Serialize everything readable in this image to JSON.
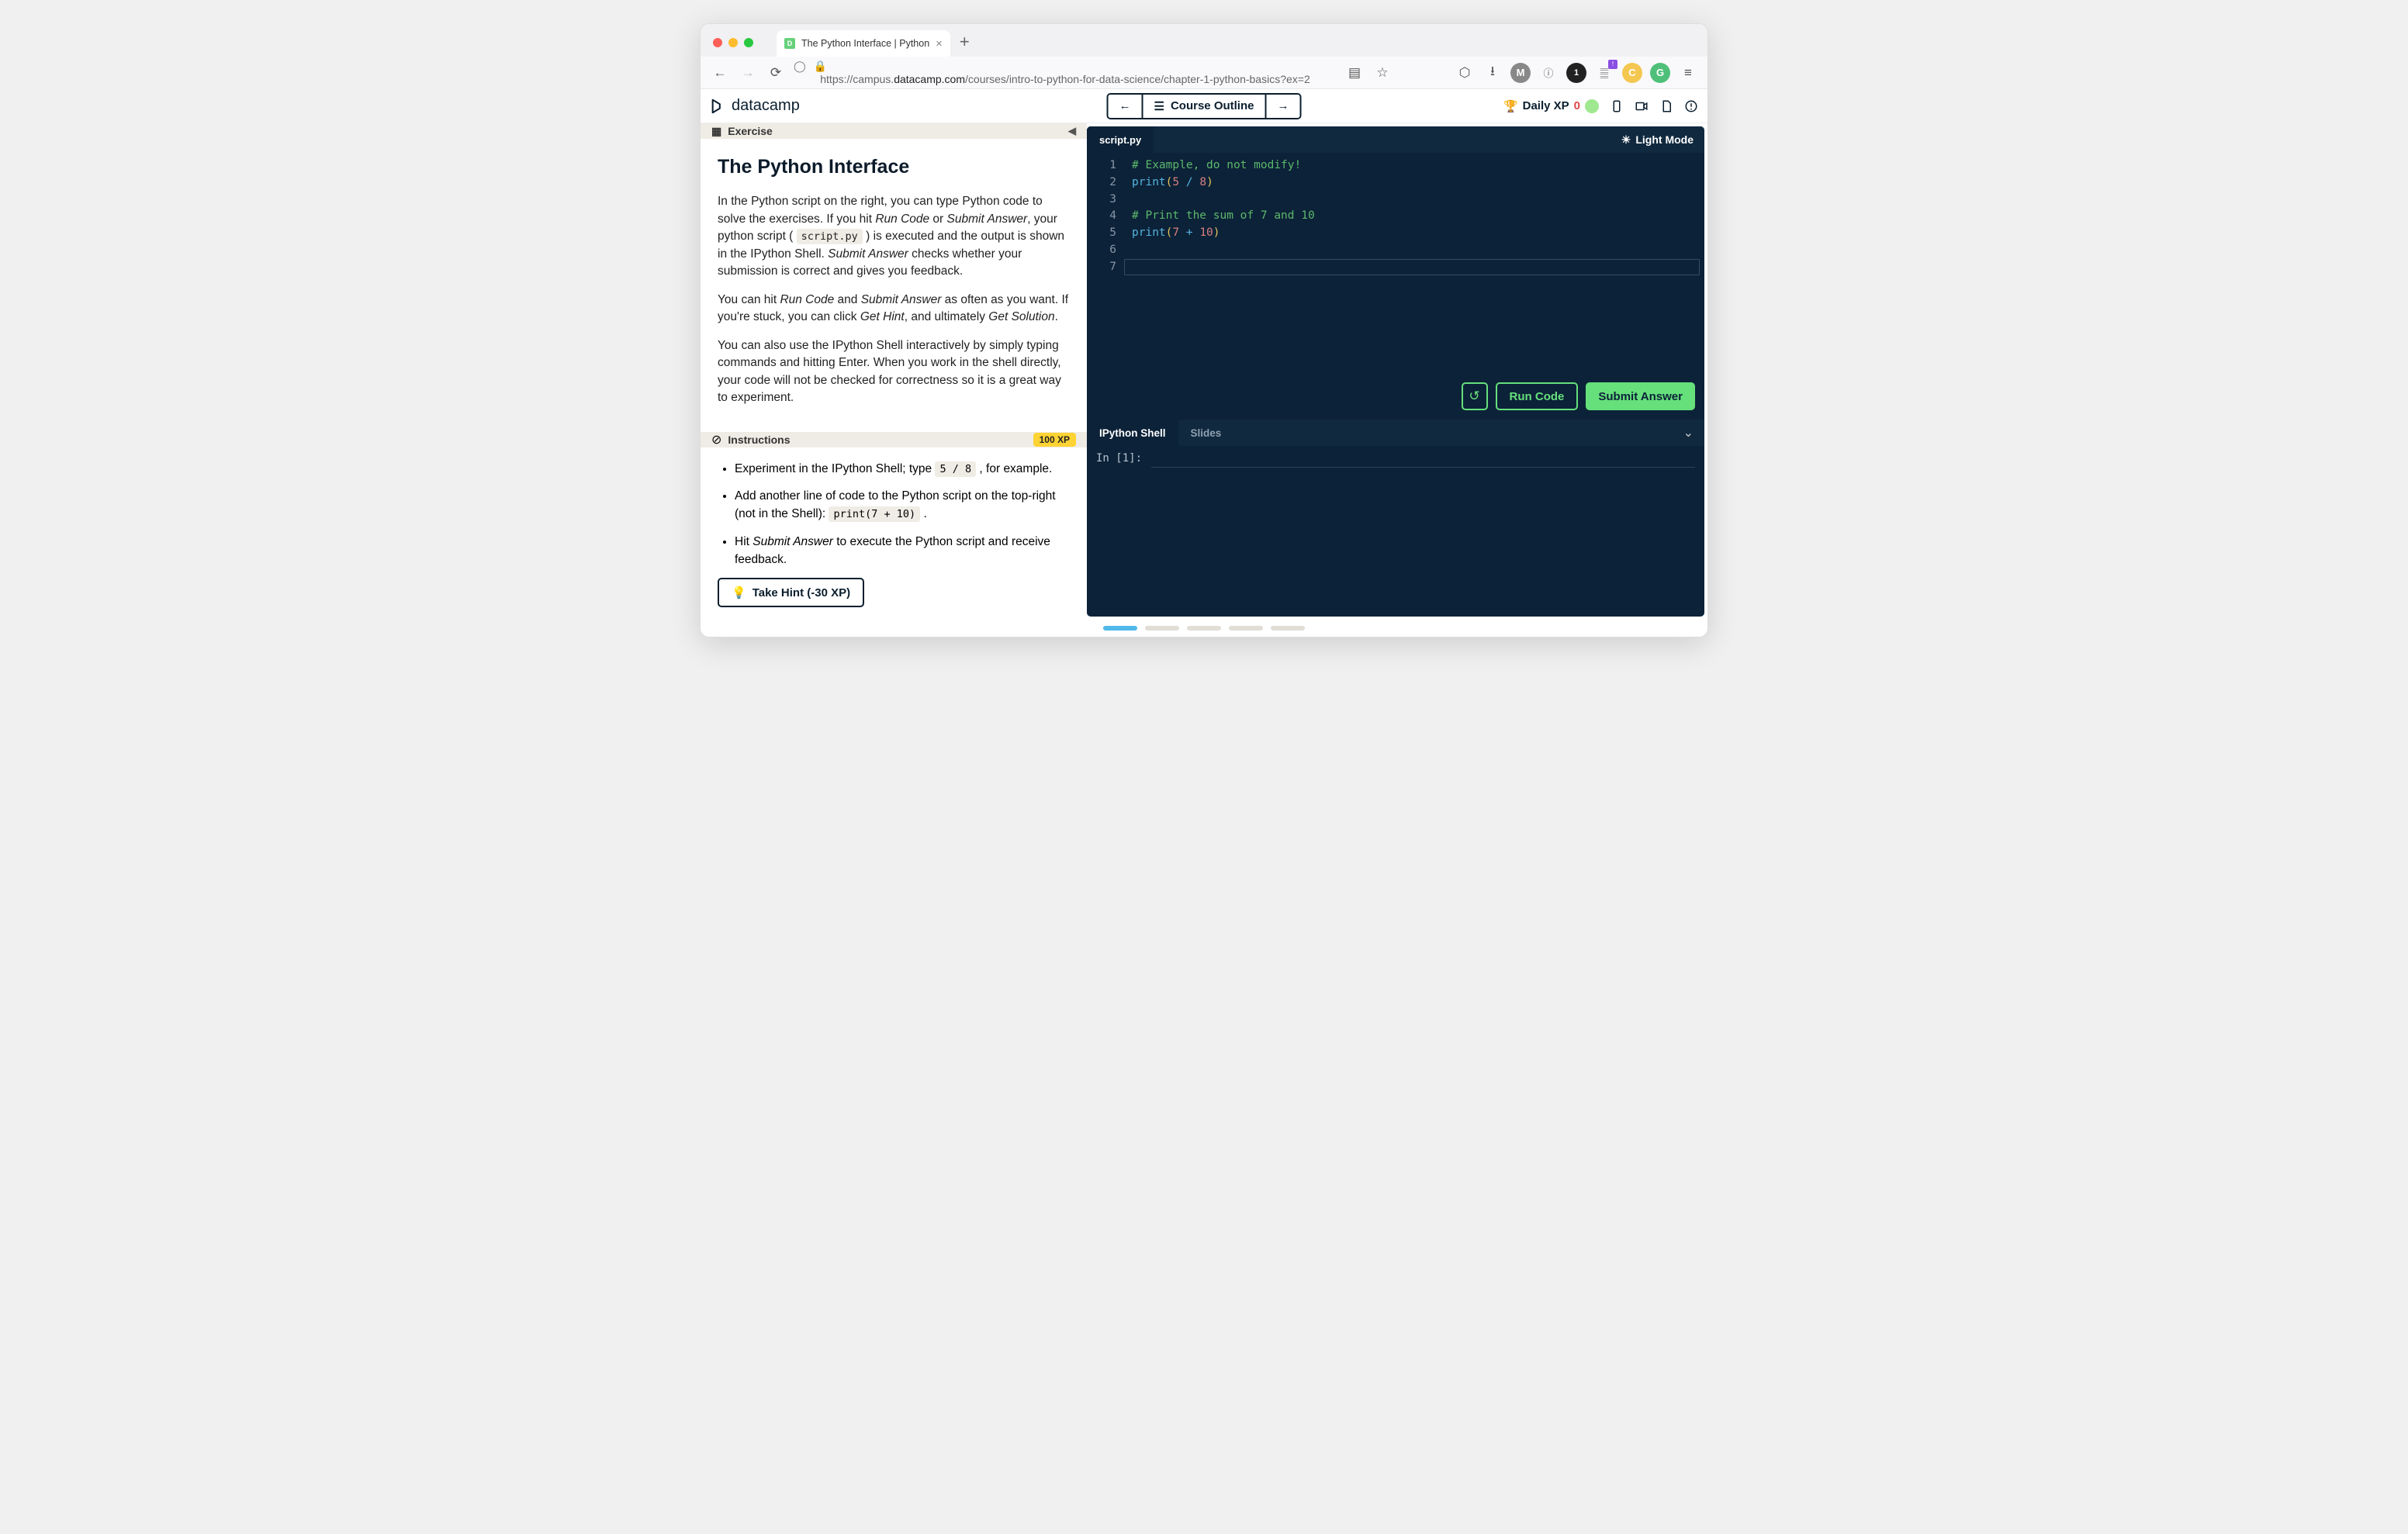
{
  "browser": {
    "tab_title": "The Python Interface | Python",
    "url_pre": "https://campus.",
    "url_domain": "datacamp.com",
    "url_path": "/courses/intro-to-python-for-data-science/chapter-1-python-basics?ex=2"
  },
  "header": {
    "logo": "datacamp",
    "course_outline": "Course Outline",
    "daily_xp_label": "Daily XP",
    "daily_xp_value": "0"
  },
  "exercise": {
    "section_label": "Exercise",
    "title": "The Python Interface",
    "p1_a": "In the Python script on the right, you can type Python code to solve the exercises. If you hit ",
    "p1_em1": "Run Code",
    "p1_b": " or ",
    "p1_em2": "Submit Answer",
    "p1_c": ", your python script ( ",
    "p1_code": "script.py",
    "p1_d": " ) is executed and the output is shown in the IPython Shell. ",
    "p1_em3": "Submit Answer",
    "p1_e": " checks whether your submission is correct and gives you feedback.",
    "p2_a": "You can hit ",
    "p2_em1": "Run Code",
    "p2_b": " and ",
    "p2_em2": "Submit Answer",
    "p2_c": " as often as you want. If you're stuck, you can click ",
    "p2_em3": "Get Hint",
    "p2_d": ", and ultimately ",
    "p2_em4": "Get Solution",
    "p2_e": ".",
    "p3": "You can also use the IPython Shell interactively by simply typing commands and hitting Enter. When you work in the shell directly, your code will not be checked for correctness so it is a great way to experiment."
  },
  "instructions": {
    "section_label": "Instructions",
    "xp_badge": "100 XP",
    "i1_a": "Experiment in the IPython Shell; type ",
    "i1_code": "5 / 8",
    "i1_b": " , for example.",
    "i2_a": "Add another line of code to the Python script on the top-right (not in the Shell): ",
    "i2_code": "print(7 + 10)",
    "i2_b": " .",
    "i3_a": "Hit ",
    "i3_em": "Submit Answer",
    "i3_b": " to execute the Python script and receive feedback.",
    "hint_label": "Take Hint (-30 XP)"
  },
  "editor": {
    "tab": "script.py",
    "light_mode": "Light Mode",
    "gutter": [
      "1",
      "2",
      "3",
      "4",
      "5",
      "6",
      "7"
    ],
    "lines": {
      "l1_comment": "# Example, do not modify!",
      "l2_fn": "print",
      "l2_n1": "5",
      "l2_op": "/",
      "l2_n2": "8",
      "l4_comment": "# Print the sum of 7 and 10",
      "l5_fn": "print",
      "l5_n1": "7",
      "l5_op": "+",
      "l5_n2": "10"
    },
    "run_label": "Run Code",
    "submit_label": "Submit Answer"
  },
  "shell": {
    "tab1": "IPython Shell",
    "tab2": "Slides",
    "prompt": "In [1]:"
  }
}
